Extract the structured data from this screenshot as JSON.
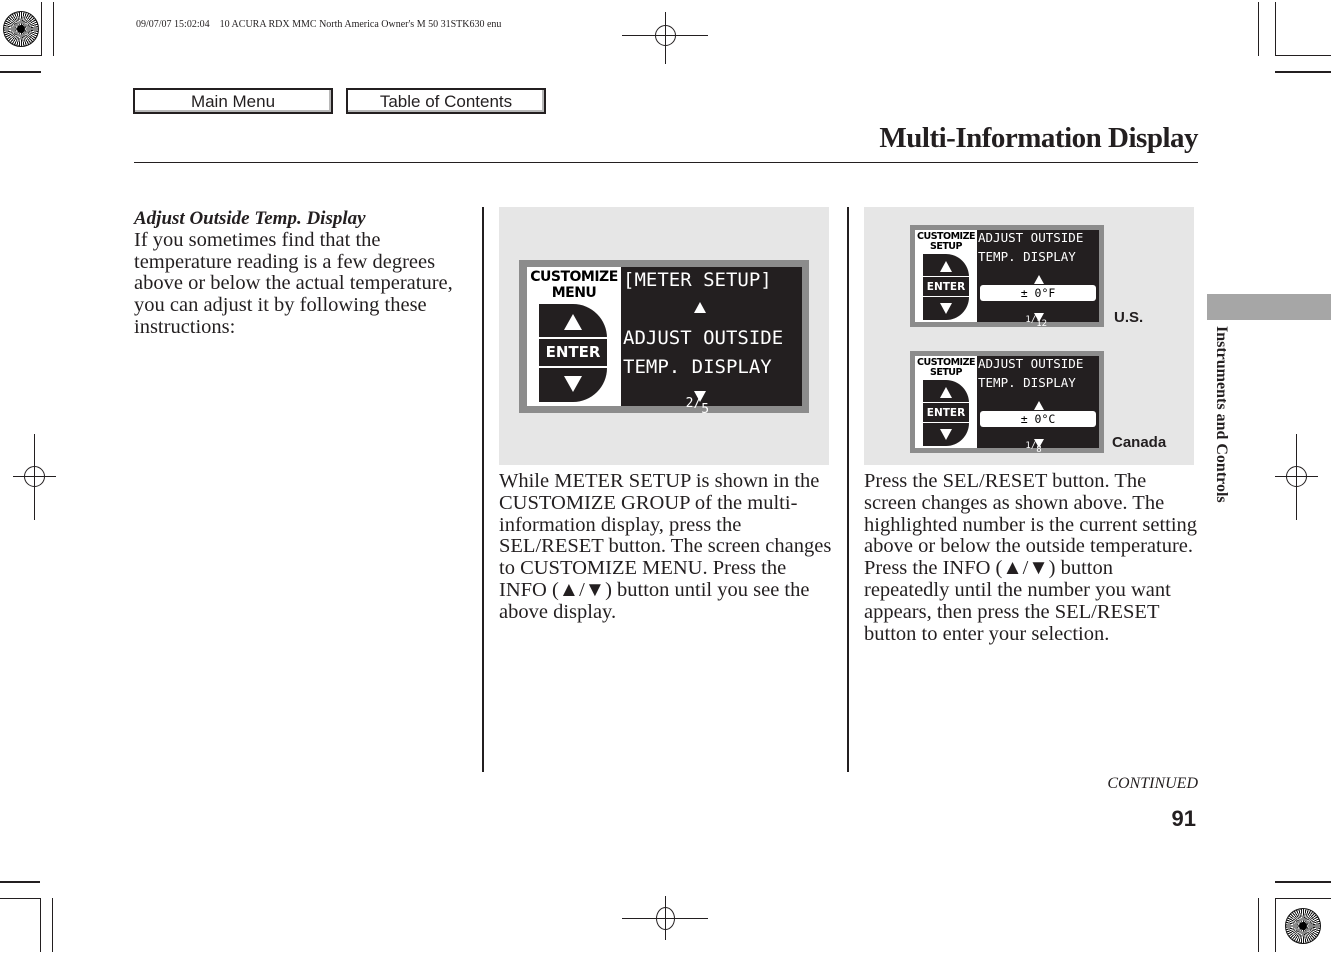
{
  "print_header": "09/07/07 15:02:04    10 ACURA RDX MMC North America Owner's M 50 31STK630 enu",
  "nav": {
    "main_menu": "Main Menu",
    "table_of_contents": "Table of Contents"
  },
  "page_title": "Multi-Information Display",
  "side_tab": "Instruments and Controls",
  "column1": {
    "heading": "Adjust Outside Temp. Display",
    "body": "If you sometimes find that the temperature reading is a few degrees above or below the actual temperature, you can adjust it by following these instructions:"
  },
  "figure1": {
    "left_label_line1": "CUSTOMIZE",
    "left_label_line2": "MENU",
    "enter": "ENTER",
    "line1": "[METER SETUP]",
    "line2": "ADJUST OUTSIDE",
    "line3": "TEMP. DISPLAY",
    "page_num": "2",
    "page_den": "5"
  },
  "column2": {
    "body": "While METER SETUP is shown in the CUSTOMIZE GROUP of the multi-information display, press the SEL/RESET button. The screen changes to CUSTOMIZE MENU. Press the INFO (▲/▼) button until you see the above display."
  },
  "figure2": {
    "screens": [
      {
        "region": "U.S.",
        "left_label_line1": "CUSTOMIZE",
        "left_label_line2": "SETUP",
        "enter": "ENTER",
        "line1": "ADJUST OUTSIDE",
        "line2": "TEMP. DISPLAY",
        "value": "± 0°F",
        "page_num": "1",
        "page_den": "12"
      },
      {
        "region": "Canada",
        "left_label_line1": "CUSTOMIZE",
        "left_label_line2": "SETUP",
        "enter": "ENTER",
        "line1": "ADJUST OUTSIDE",
        "line2": "TEMP. DISPLAY",
        "value": "± 0°C",
        "page_num": "1",
        "page_den": "8"
      }
    ]
  },
  "column3": {
    "body": "Press the SEL/RESET button. The screen changes as shown above. The highlighted number is the current setting above or below the outside temperature. Press the INFO (▲/▼) button repeatedly until the number you want appears, then press the SEL/RESET button to enter your selection."
  },
  "continued": "CONTINUED",
  "page_number": "91"
}
